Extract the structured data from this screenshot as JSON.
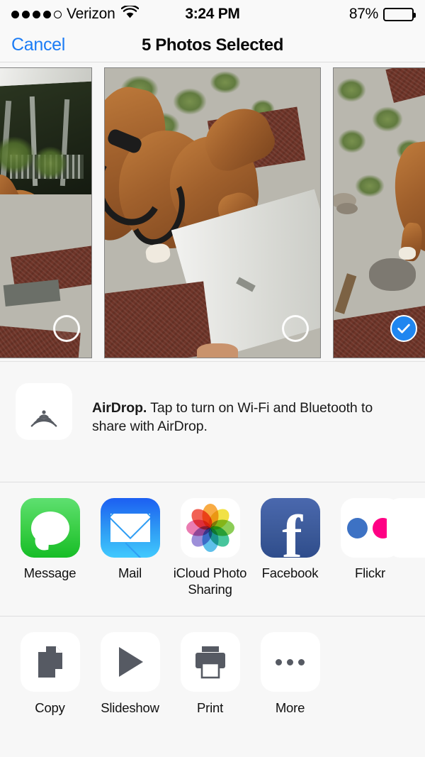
{
  "status_bar": {
    "signal_dots_total": 5,
    "signal_dots_filled": 4,
    "carrier": "Verizon",
    "wifi_icon": "wifi-icon",
    "time": "3:24 PM",
    "battery_percent": "87%",
    "battery_level": 87
  },
  "nav_bar": {
    "cancel_label": "Cancel",
    "title": "5 Photos Selected"
  },
  "photo_strip": {
    "photos": [
      {
        "name": "photo-1",
        "alt": "Brown dog near metal frame and gravel",
        "selected": false,
        "badge": "empty-circle-icon"
      },
      {
        "name": "photo-2",
        "alt": "Brown dog in harness standing on gravel near white panel",
        "selected": false,
        "badge": "empty-circle-icon"
      },
      {
        "name": "photo-3",
        "alt": "Gravel with dog hindquarters and red paver",
        "selected": true,
        "badge": "checkmark-circle-icon"
      }
    ],
    "selected_count": 5
  },
  "airdrop": {
    "icon": "airdrop-icon",
    "title": "AirDrop.",
    "description": " Tap to turn on Wi-Fi and Bluetooth to share with AirDrop."
  },
  "share_apps": [
    {
      "label": "Message",
      "icon": "message-icon"
    },
    {
      "label": "Mail",
      "icon": "mail-icon"
    },
    {
      "label": "iCloud Photo Sharing",
      "icon": "icloud-photo-sharing-icon"
    },
    {
      "label": "Facebook",
      "icon": "facebook-icon"
    },
    {
      "label": "Flickr",
      "icon": "flickr-icon"
    }
  ],
  "actions": [
    {
      "label": "Copy",
      "icon": "copy-icon"
    },
    {
      "label": "Slideshow",
      "icon": "play-icon"
    },
    {
      "label": "Print",
      "icon": "printer-icon"
    },
    {
      "label": "More",
      "icon": "ellipsis-icon"
    }
  ],
  "colors": {
    "accent_blue": "#1c7cf5",
    "selection_blue": "#1f86f0",
    "background": "#f7f7f7",
    "message_green": "#3ccf48",
    "mail_blue": "#2f9df4",
    "facebook_blue": "#3b5998",
    "flickr_blue": "#3d72c4",
    "flickr_pink": "#ff0084",
    "glyph_gray": "#565a63"
  }
}
